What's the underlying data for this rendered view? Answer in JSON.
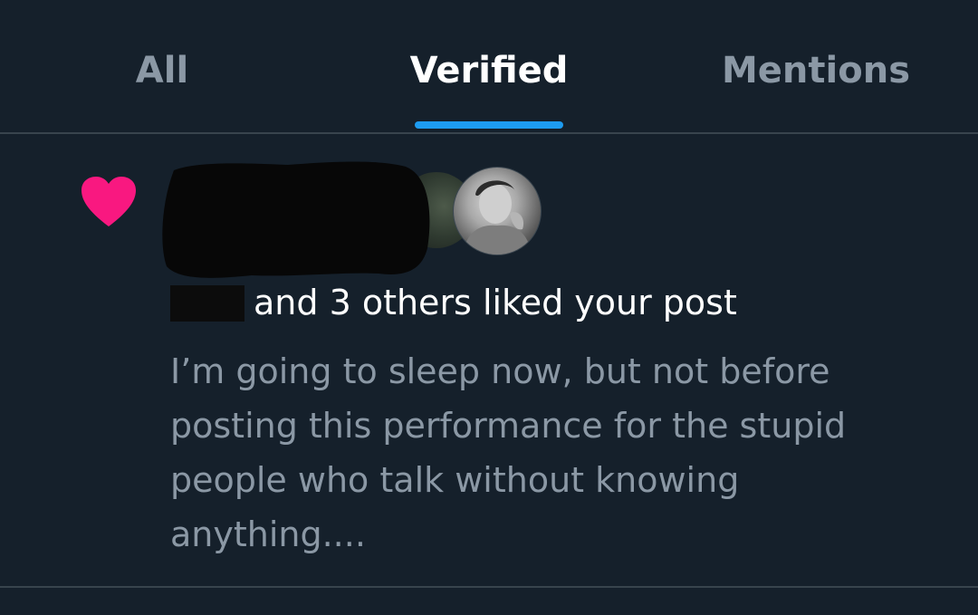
{
  "tabs": {
    "all": "All",
    "verified": "Verified",
    "mentions": "Mentions",
    "active": "verified"
  },
  "colors": {
    "background": "#15202b",
    "accent": "#1d9bf0",
    "heart": "#f91880",
    "muted_text": "#8b98a5",
    "divider": "#38444d"
  },
  "notification": {
    "type_icon": "heart-icon",
    "actor_summary": "and 3 others liked your post",
    "post_text": "I’m going to sleep now, but not before posting this performance for the stupid people who talk without knowing anything...."
  }
}
